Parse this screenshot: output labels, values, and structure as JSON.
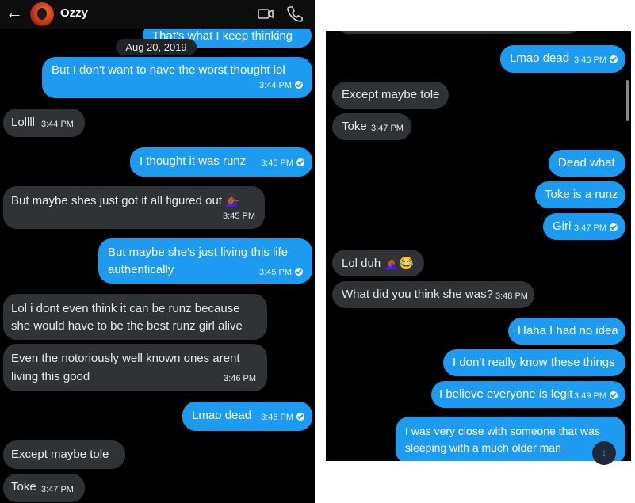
{
  "header": {
    "back_label": "←",
    "contact_name": "Ozzy"
  },
  "date_separator": "Aug 20, 2019",
  "left_messages": [
    {
      "text": "That's what I keep thinking",
      "time": "",
      "dir": "out"
    },
    {
      "text": "But I don't want to have the worst thought lol",
      "time": "3:44 PM",
      "dir": "out",
      "read": true
    },
    {
      "text": "Lollll",
      "time": "3:44 PM",
      "dir": "in"
    },
    {
      "text": "I thought it was runz",
      "time": "3:45 PM",
      "dir": "out",
      "read": true
    },
    {
      "text": "But maybe shes just got it all figured out 💁🏾‍♀️",
      "time": "3:45 PM",
      "dir": "in"
    },
    {
      "text_line1": "But maybe she's just living this life",
      "text_line2": "authentically",
      "time": "3:45 PM",
      "dir": "out",
      "read": true
    },
    {
      "text_line1": "Lol i dont even think it can be runz because",
      "text_line2": "she would have to be the best runz girl alive",
      "time": "",
      "dir": "in"
    },
    {
      "text_line1": "Even the notoriously well known ones arent",
      "text_line2": "living this good",
      "time": "3:46 PM",
      "dir": "in"
    },
    {
      "text": "Lmao dead",
      "time": "3:46 PM",
      "dir": "out",
      "read": true
    },
    {
      "text": "Except maybe tole",
      "time": "",
      "dir": "in"
    },
    {
      "text": "Toke",
      "time": "3:47 PM",
      "dir": "in"
    }
  ],
  "right_messages": [
    {
      "text": "Lmao dead",
      "time": "3:46 PM",
      "dir": "out",
      "read": true
    },
    {
      "text": "Except maybe tole",
      "time": "",
      "dir": "in"
    },
    {
      "text": "Toke",
      "time": "3:47 PM",
      "dir": "in"
    },
    {
      "text": "Dead what",
      "time": "",
      "dir": "out"
    },
    {
      "text": "Toke is a runz",
      "time": "",
      "dir": "out"
    },
    {
      "text": "Girl",
      "time": "3:47 PM",
      "dir": "out",
      "read": true
    },
    {
      "text": "Lol duh 🤦🏾‍♀️😂",
      "time": "",
      "dir": "in"
    },
    {
      "text": "What did you think she was?",
      "time": "3:48 PM",
      "dir": "in"
    },
    {
      "text": "Haha I had no idea",
      "time": "",
      "dir": "out"
    },
    {
      "text": "I don't really know these things",
      "time": "",
      "dir": "out"
    },
    {
      "text": "I believe everyone is legit",
      "time": "3:49 PM",
      "dir": "out",
      "read": true
    },
    {
      "text_line1": "I was very close with someone that was",
      "text_line2": "sleeping with a much older man",
      "time": "",
      "dir": "out"
    }
  ],
  "icons": {
    "back": "arrow-left-icon",
    "video": "video-camera-icon",
    "call": "phone-icon",
    "read": "read-receipt-icon",
    "scroll_down": "arrow-down-icon"
  },
  "scroll_down_label": "↓",
  "colors": {
    "outgoing": "#1d9bf0",
    "incoming": "#2f3336",
    "background": "#000000"
  }
}
